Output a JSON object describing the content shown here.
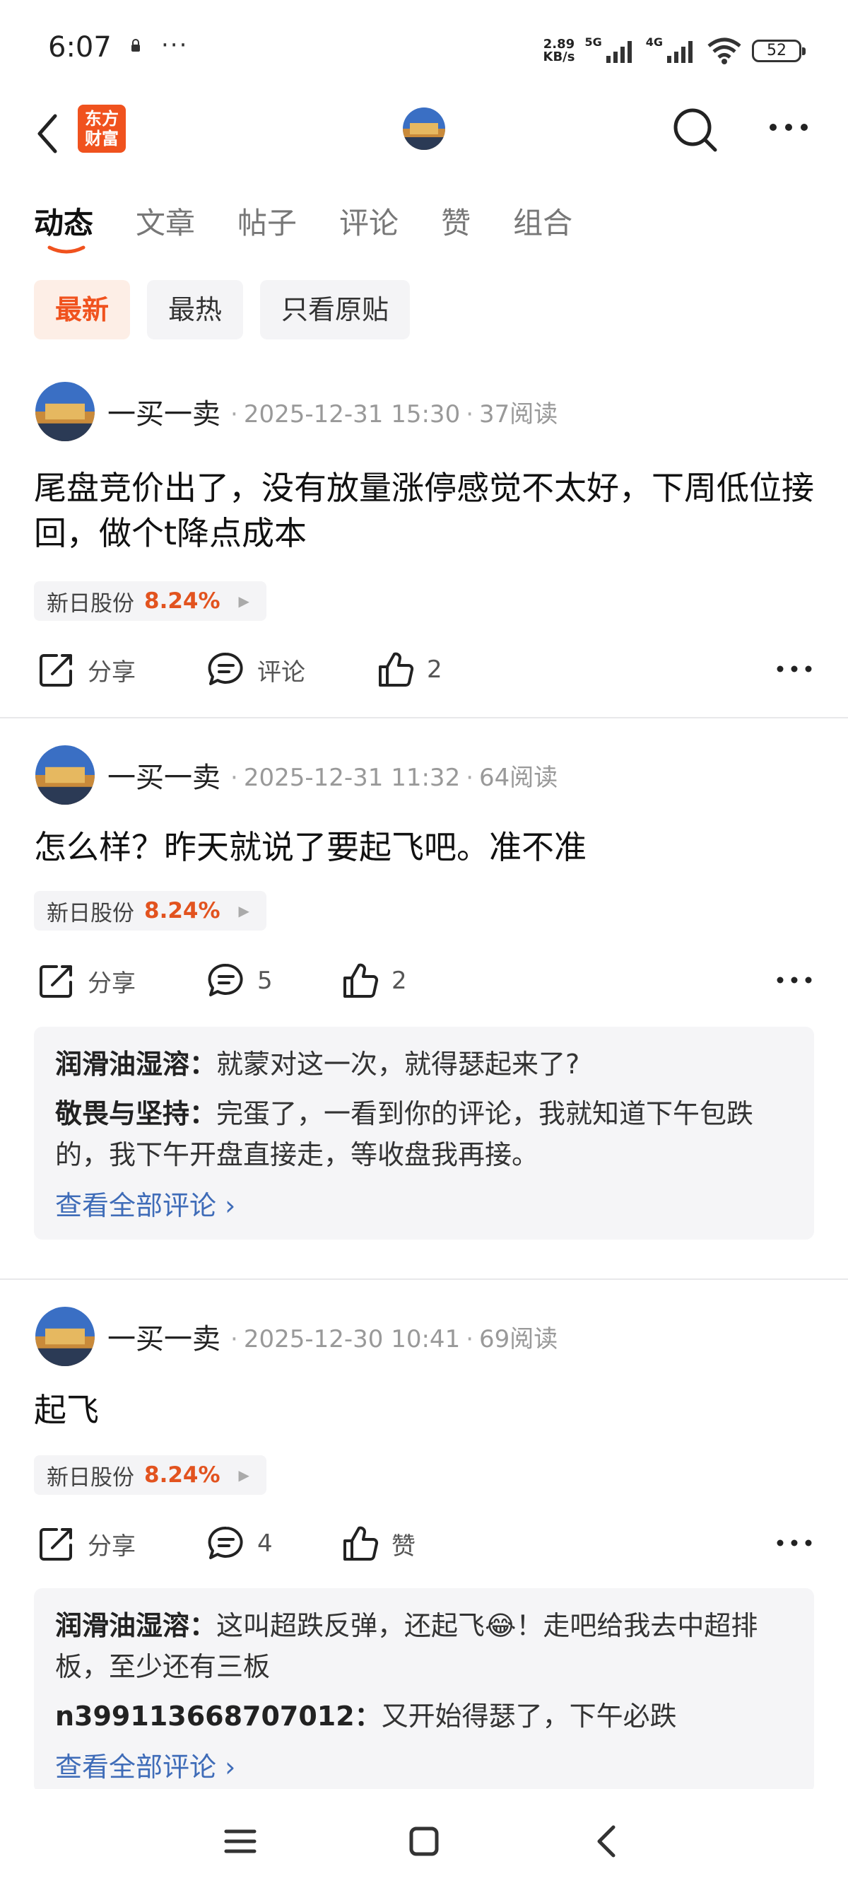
{
  "status_bar": {
    "time": "6:07",
    "dots": "···",
    "net_speed_value": "2.89",
    "net_speed_unit": "KB/s",
    "signal_1": "5G",
    "signal_2": "4G",
    "battery": "52"
  },
  "nav": {
    "logo_line1": "东方",
    "logo_line2": "财富"
  },
  "tabs": [
    {
      "label": "动态",
      "active": true
    },
    {
      "label": "文章"
    },
    {
      "label": "帖子"
    },
    {
      "label": "评论"
    },
    {
      "label": "赞"
    },
    {
      "label": "组合"
    }
  ],
  "filters": [
    {
      "label": "最新",
      "active": true
    },
    {
      "label": "最热"
    },
    {
      "label": "只看原贴"
    }
  ],
  "posts": [
    {
      "author": "一买一卖",
      "date": "2025-12-31 15:30",
      "reads": "37阅读",
      "text": "尾盘竞价出了，没有放量涨停感觉不太好，下周低位接回，做个t降点成本",
      "stock": "新日股份",
      "pct": "8.24%",
      "share": "分享",
      "comment": "评论",
      "like": "2"
    },
    {
      "author": "一买一卖",
      "date": "2025-12-31 11:32",
      "reads": "64阅读",
      "text": "怎么样？昨天就说了要起飞吧。准不准",
      "stock": "新日股份",
      "pct": "8.24%",
      "share": "分享",
      "comment": "5",
      "like": "2",
      "comments": [
        {
          "user": "润滑油湿溶：",
          "text": "就蒙对这一次，就得瑟起来了?"
        },
        {
          "user": "敬畏与坚持：",
          "text": "完蛋了，一看到你的评论，我就知道下午包跌的，我下午开盘直接走，等收盘我再接。"
        }
      ],
      "view_all": "查看全部评论 ›"
    },
    {
      "author": "一买一卖",
      "date": "2025-12-30 10:41",
      "reads": "69阅读",
      "text": "起飞",
      "stock": "新日股份",
      "pct": "8.24%",
      "share": "分享",
      "comment": "4",
      "like": "赞",
      "comments": [
        {
          "user": "润滑油湿溶：",
          "text": "这叫超跌反弹，还起飞😂！走吧给我去中超排板，至少还有三板"
        },
        {
          "user": "n399113668707012：",
          "text": "又开始得瑟了，下午必跌"
        }
      ],
      "view_all": "查看全部评论 ›"
    }
  ],
  "colors": {
    "brand": "#f0521e",
    "gain": "#e2531f",
    "link": "#3f6cb8"
  }
}
